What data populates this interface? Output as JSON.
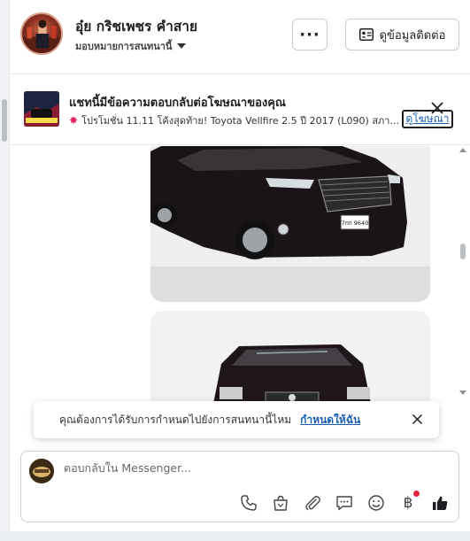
{
  "header": {
    "contact_name": "อุ๋ย กริชเพชร คำสาย",
    "assign_label": "มอบหมายการสนทนานี้",
    "more_label": "···",
    "contact_info_label": "ดูข้อมูลติดต่อ"
  },
  "ad_banner": {
    "title": "แชทนี้มีข้อความตอบกลับต่อโฆษณาของคุณ",
    "subtitle": "โปรโมชั่น 11.11 โค้งสุดท้าย! Toyota Vellfire 2.5 ปี 2017 (L090) สภา...",
    "view_ad_label": "ดูโฆษณา",
    "plate_text": "7กก 9640"
  },
  "toast": {
    "text": "คุณต้องการได้รับการกำหนดไปยังการสนทนานี้ไหม",
    "action_label": "กำหนดให้ฉัน"
  },
  "composer": {
    "placeholder": "ตอบกลับใน Messenger...",
    "baht_symbol": "฿"
  },
  "colors": {
    "link": "#1a5fb4",
    "notification_dot": "#e41e3f",
    "like_icon": "#1c1e21"
  },
  "icons": [
    "phone-icon",
    "shopping-bag-icon",
    "attachment-icon",
    "saved-reply-icon",
    "emoji-icon",
    "baht-icon",
    "like-icon"
  ]
}
